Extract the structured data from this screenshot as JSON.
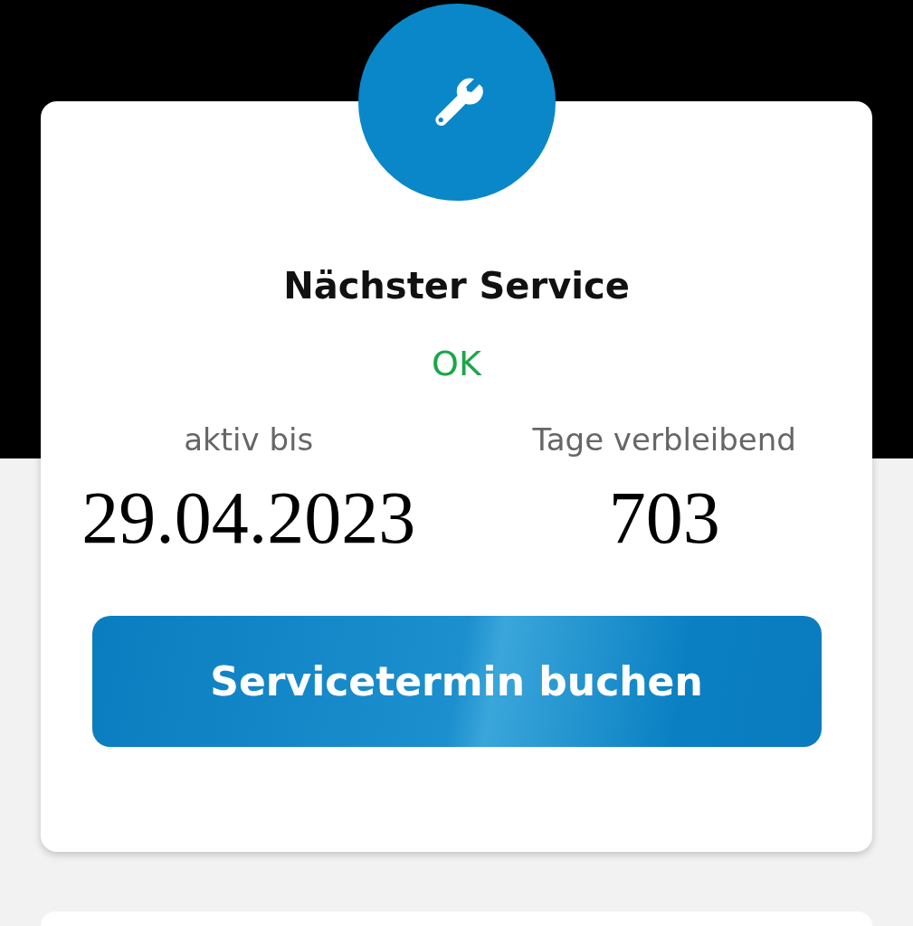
{
  "service_card": {
    "title": "Nächster Service",
    "status": {
      "text": "OK",
      "kind": "ok"
    },
    "stats": [
      {
        "label": "aktiv bis",
        "value": "29.04.2023"
      },
      {
        "label": "Tage verbleibend",
        "value": "703"
      }
    ],
    "button": "Servicetermin buchen"
  }
}
